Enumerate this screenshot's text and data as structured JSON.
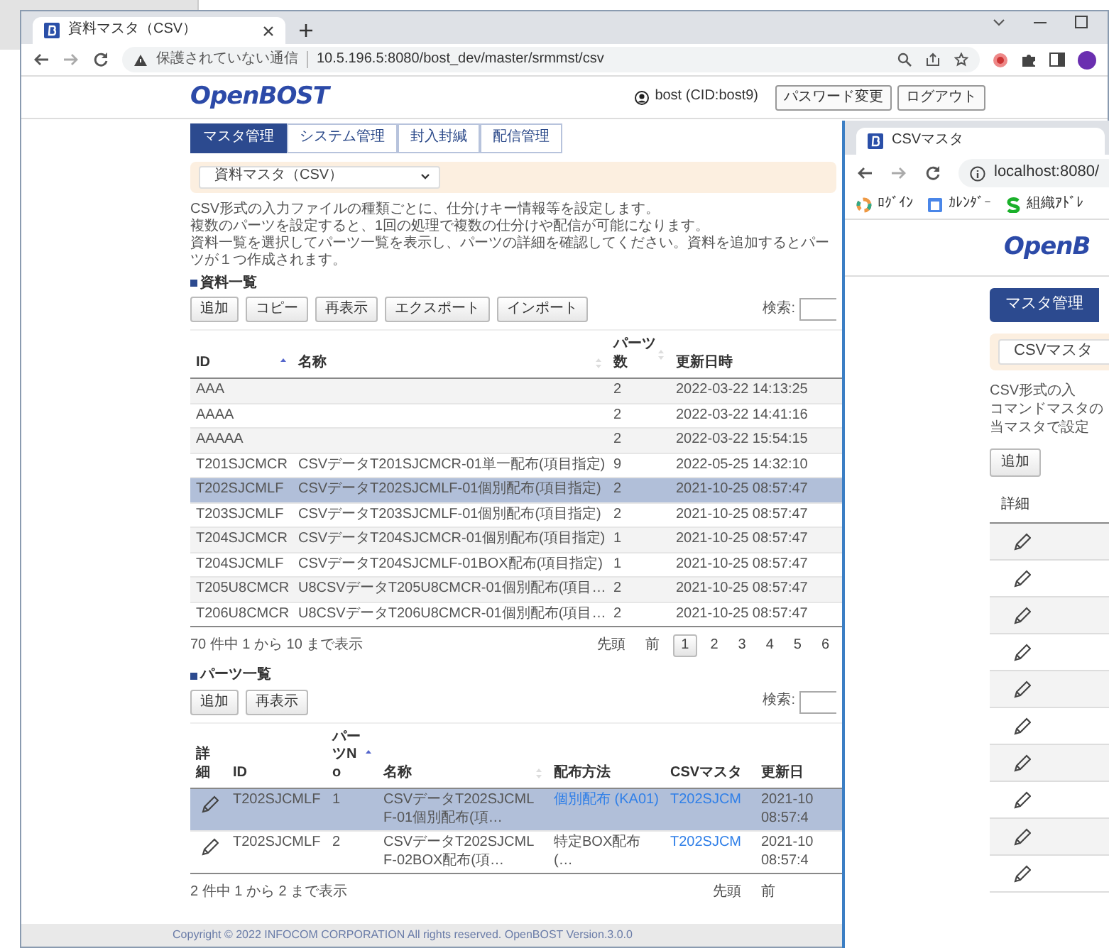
{
  "browser": {
    "tab_title": "資料マスタ（CSV）",
    "security_label": "保護されていない通信",
    "url": "10.5.196.5:8080/bost_dev/master/srmmst/csv"
  },
  "header": {
    "logo": "OpenBOST",
    "user": "bost (CID:bost9)",
    "buttons": [
      "パスワード変更",
      "ログアウト"
    ]
  },
  "nav_tabs": [
    {
      "label": "マスタ管理",
      "selected": true
    },
    {
      "label": "システム管理",
      "selected": false
    },
    {
      "label": "封入封緘",
      "selected": false
    },
    {
      "label": "配信管理",
      "selected": false
    }
  ],
  "master_select": {
    "value": "資料マスタ（CSV）"
  },
  "description": [
    "CSV形式の入力ファイルの種類ごとに、仕分けキー情報等を設定します。",
    "複数のパーツを設定すると、1回の処理で複数の仕分けや配信が可能になります。",
    "資料一覧を選択してパーツ一覧を表示し、パーツの詳細を確認してください。資料を追加するとパーツが１つ作成されます。"
  ],
  "documents": {
    "heading": "資料一覧",
    "buttons": [
      "追加",
      "コピー",
      "再表示",
      "エクスポート",
      "インポート"
    ],
    "search_label": "検索:",
    "columns": [
      {
        "label": "ID",
        "kind": "ascending"
      },
      {
        "label": "名称",
        "kind": "sortable"
      },
      {
        "label": "パーツ数",
        "kind": "sortable"
      },
      {
        "label": "更新日時",
        "kind": "plain"
      }
    ],
    "rows": [
      {
        "id": "AAA",
        "parts": "2",
        "updated": "2022-03-22 14:13:25",
        "selected": false
      },
      {
        "id": "AAAA",
        "parts": "2",
        "updated": "2022-03-22 14:41:16",
        "selected": false
      },
      {
        "id": "AAAAA",
        "parts": "2",
        "updated": "2022-03-22 15:54:15",
        "selected": false
      },
      {
        "id": "T201SJCMCR",
        "name": "CSVデータT201SJCMCR-01単一配布(項目指定)",
        "parts": "9",
        "updated": "2022-05-25 14:32:10",
        "selected": false
      },
      {
        "id": "T202SJCMLF",
        "name": "CSVデータT202SJCMLF-01個別配布(項目指定)",
        "parts": "2",
        "updated": "2021-10-25 08:57:47",
        "selected": true
      },
      {
        "id": "T203SJCMLF",
        "name": "CSVデータT203SJCMLF-01個別配布(項目指定)",
        "parts": "2",
        "updated": "2021-10-25 08:57:47",
        "selected": false
      },
      {
        "id": "T204SJCMCR",
        "name": "CSVデータT204SJCMCR-01個別配布(項目指定)",
        "parts": "1",
        "updated": "2021-10-25 08:57:47",
        "selected": false
      },
      {
        "id": "T204SJCMLF",
        "name": "CSVデータT204SJCMLF-01BOX配布(項目指定)",
        "parts": "1",
        "updated": "2021-10-25 08:57:47",
        "selected": false
      },
      {
        "id": "T205U8CMCR",
        "name": "U8CSVデータT205U8CMCR-01個別配布(項目…",
        "parts": "2",
        "updated": "2021-10-25 08:57:47",
        "selected": false
      },
      {
        "id": "T206U8CMCR",
        "name": "U8CSVデータT206U8CMCR-01個別配布(項目…",
        "parts": "2",
        "updated": "2021-10-25 08:57:47",
        "selected": false
      }
    ],
    "info": "70 件中 1 から 10 まで表示",
    "pager": {
      "first": "先頭",
      "prev": "前",
      "pages": [
        {
          "label": "1",
          "selected": true
        },
        {
          "label": "2",
          "selected": false
        },
        {
          "label": "3",
          "selected": false
        },
        {
          "label": "4",
          "selected": false
        },
        {
          "label": "5",
          "selected": false
        },
        {
          "label": "6",
          "selected": false
        }
      ]
    }
  },
  "parts": {
    "heading": "パーツ一覧",
    "buttons": [
      "追加",
      "再表示"
    ],
    "search_label": "検索:",
    "columns": [
      {
        "label": "詳細",
        "kind": "plain"
      },
      {
        "label": "ID",
        "kind": "plain"
      },
      {
        "label": "パーツNo",
        "kind": "ascending"
      },
      {
        "label": "名称",
        "kind": "sortable"
      },
      {
        "label": "配布方法",
        "kind": "plain"
      },
      {
        "label": "CSVマスタ",
        "kind": "plain"
      },
      {
        "label": "更新日",
        "kind": "plain"
      }
    ],
    "rows": [
      {
        "id": "T202SJCMLF",
        "no": "1",
        "name": "CSVデータT202SJCMLF-01個別配布(項…",
        "method": {
          "text": "個別配布 (KA01)",
          "link": true
        },
        "csv_master": "T202SJCM",
        "updated": [
          "2021-10",
          "08:57:4"
        ],
        "selected": true
      },
      {
        "id": "T202SJCMLF",
        "no": "2",
        "name": "CSVデータT202SJCMLF-02BOX配布(項…",
        "method": {
          "text": "特定BOX配布 (…",
          "link": false
        },
        "csv_master": "T202SJCM",
        "updated": [
          "2021-10",
          "08:57:4"
        ],
        "selected": false
      }
    ],
    "info": "2 件中 1 から 2 まで表示",
    "pager": {
      "first": "先頭",
      "prev": "前"
    }
  },
  "footer": "Copyright © 2022 INFOCOM CORPORATION All rights reserved. OpenBOST Version.3.0.0",
  "second_window": {
    "tab_title": "CSVマスタ",
    "url": "localhost:8080/",
    "bookmarks": [
      {
        "kind": "ring",
        "label": "ﾛｸﾞｲﾝ"
      },
      {
        "kind": "calendar",
        "label": "ｶﾚﾝﾀﾞｰ"
      },
      {
        "kind": "curve",
        "label": "組織ｱﾄﾞﾚ"
      }
    ],
    "logo": "OpenB",
    "nav_tab": "マスタ管理",
    "select_value": "CSVマスタ",
    "description": [
      "CSV形式の入",
      "コマンドマスタの",
      "当マスタで設定"
    ],
    "button": "追加",
    "detail_column": "詳細",
    "rows": [
      {
        "kind": "edit"
      },
      {
        "kind": "edit"
      },
      {
        "kind": "edit"
      },
      {
        "kind": "edit"
      },
      {
        "kind": "edit"
      },
      {
        "kind": "edit"
      },
      {
        "kind": "edit"
      },
      {
        "kind": "edit"
      },
      {
        "kind": "edit"
      },
      {
        "kind": "edit"
      }
    ]
  }
}
